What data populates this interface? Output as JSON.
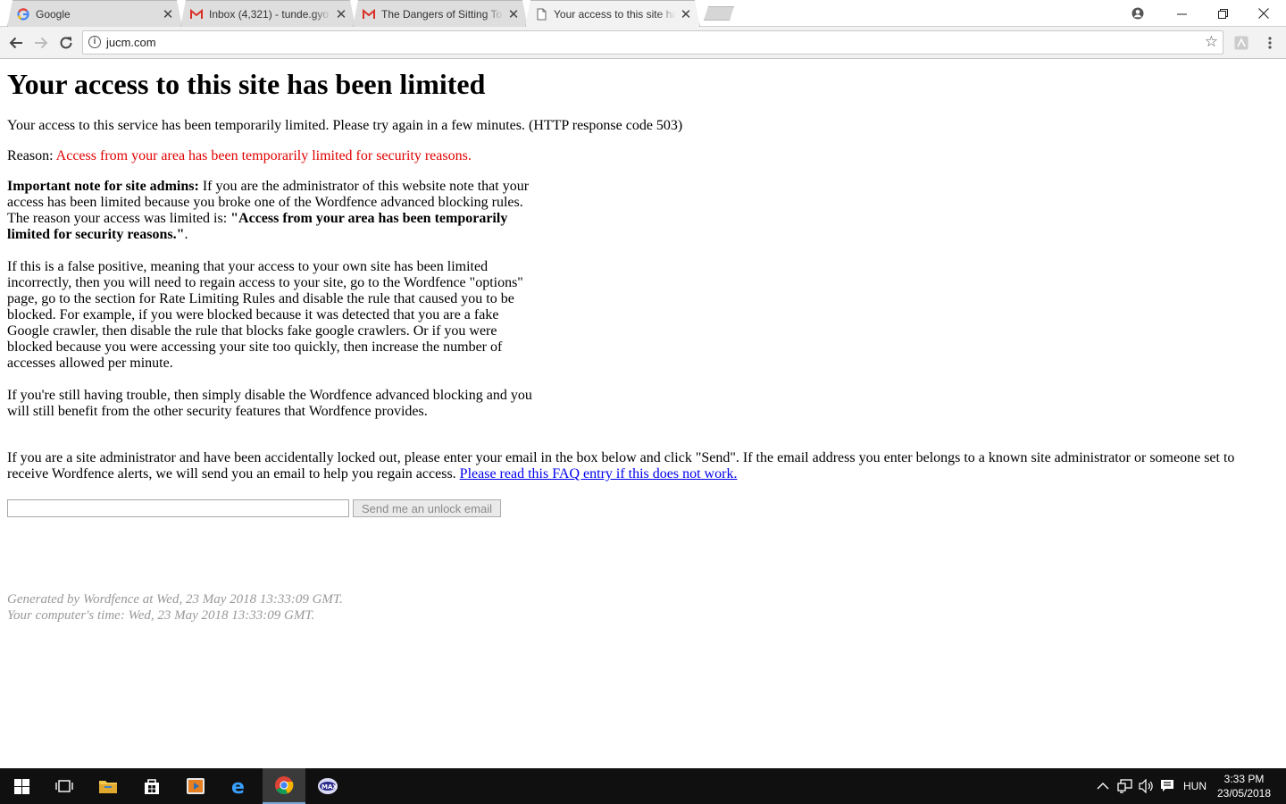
{
  "browser": {
    "tabs": [
      {
        "title": "Google",
        "icon": "google-favicon",
        "active": false
      },
      {
        "title": "Inbox (4,321) - tunde.gyo",
        "icon": "gmail-favicon",
        "active": false
      },
      {
        "title": "The Dangers of Sitting To",
        "icon": "gmail-favicon",
        "active": false
      },
      {
        "title": "Your access to this site ha",
        "icon": "page-icon",
        "active": true
      }
    ],
    "url": "jucm.com",
    "close_glyph": "✕",
    "colors": {
      "tab_bg": "#dedede",
      "active_tab_bg": "#f2f2f2",
      "toolbar_bg": "#f2f2f2"
    }
  },
  "page": {
    "heading": "Your access to this site has been limited",
    "intro": "Your access to this service has been temporarily limited. Please try again in a few minutes. (HTTP response code 503)",
    "reason_label": "Reason: ",
    "reason_text": "Access from your area has been temporarily limited for security reasons.",
    "admin_note_label": "Important note for site admins:",
    "admin_note_text": " If you are the administrator of this website note that your access has been limited because you broke one of the Wordfence advanced blocking rules. The reason your access was limited is: ",
    "admin_note_reason": "\"Access from your area has been temporarily limited for security reasons.\"",
    "admin_note_end": ".",
    "false_positive": "If this is a false positive, meaning that your access to your own site has been limited incorrectly, then you will need to regain access to your site, go to the Wordfence \"options\" page, go to the section for Rate Limiting Rules and disable the rule that caused you to be blocked. For example, if you were blocked because it was detected that you are a fake Google crawler, then disable the rule that blocks fake google crawlers. Or if you were blocked because you were accessing your site too quickly, then increase the number of accesses allowed per minute.",
    "still_trouble": "If you're still having trouble, then simply disable the Wordfence advanced blocking and you will still benefit from the other security features that Wordfence provides.",
    "locked_out": "If you are a site administrator and have been accidentally locked out, please enter your email in the box below and click \"Send\". If the email address you enter belongs to a known site administrator or someone set to receive Wordfence alerts, we will send you an email to help you regain access. ",
    "faq_link": "Please read this FAQ entry if this does not work.",
    "email_value": "",
    "unlock_button": "Send me an unlock email",
    "generated": "Generated by Wordfence at Wed, 23 May 2018 13:33:09 GMT.",
    "computer_time": "Your computer's time: Wed, 23 May 2018 13:33:09 GMT.",
    "colors": {
      "reason": "#e00000",
      "link": "#0000ee",
      "footer": "#999999"
    }
  },
  "taskbar": {
    "apps": [
      "start-icon",
      "task-view-icon",
      "file-explorer-icon",
      "store-icon",
      "media-player-icon",
      "edge-icon",
      "chrome-icon",
      "max-app-icon"
    ],
    "active_app": "chrome-icon",
    "language": "HUN",
    "time": "3:33 PM",
    "date": "23/05/2018"
  }
}
